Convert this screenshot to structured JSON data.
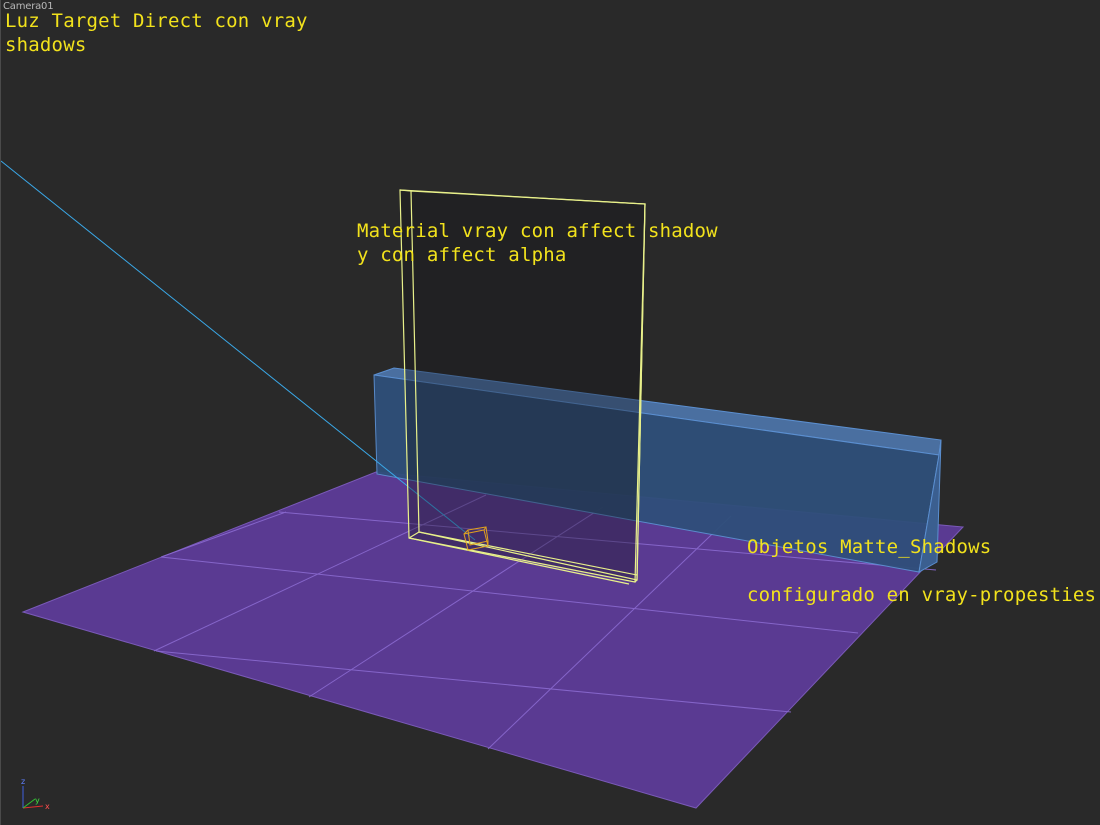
{
  "viewport": {
    "label": "Camera01"
  },
  "annotations": {
    "light": {
      "line1": "Luz Target Direct con vray",
      "line2": "shadows"
    },
    "material": {
      "line1": "Material vray con affect shadow",
      "line2": "y con affect alpha"
    },
    "matte": {
      "line1": "Objetos Matte_Shadows",
      "line2": "configurado en vray-propesties"
    }
  },
  "axis_gizmo": {
    "x": "x",
    "y": "y",
    "z": "z"
  },
  "colors": {
    "background": "#292929",
    "annotation_text": "#f2e21c",
    "ground_plane": "#5a3a92",
    "wall_box": "#2f4f7a",
    "selected_wireframe": "#e8f08a",
    "light_line": "#3aa8e8",
    "light_target": "#e0a020"
  }
}
